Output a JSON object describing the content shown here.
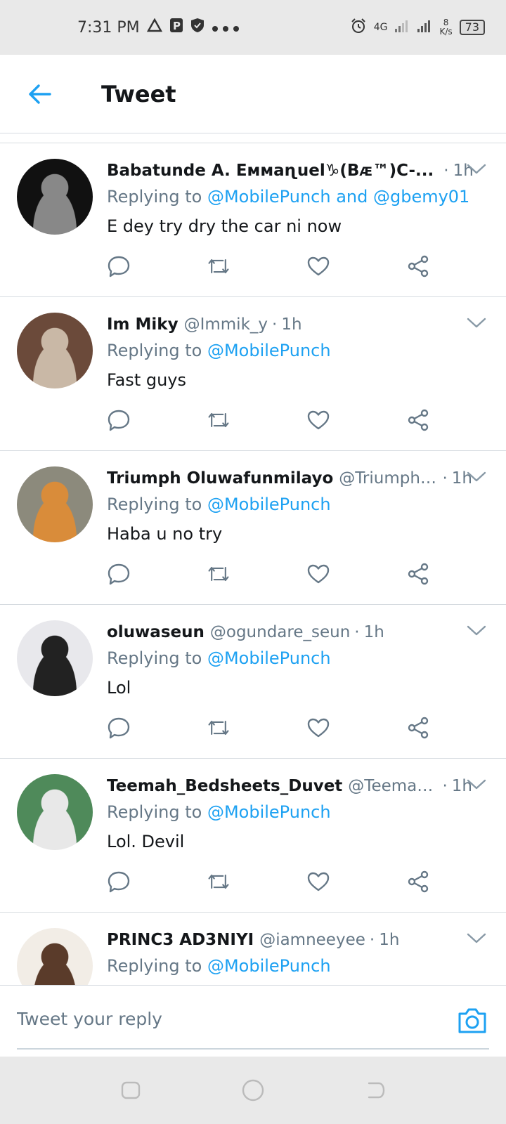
{
  "status_bar": {
    "time": "7:31 PM",
    "network": "4G",
    "speed_value": "8",
    "speed_unit": "K/s",
    "battery": "73"
  },
  "header": {
    "title": "Tweet"
  },
  "tweets": [
    {
      "name": "Babatunde A. Eᴍᴍaɳuel♑(Bᴁ™)C-...",
      "handle": "",
      "time": "1h",
      "replying_prefix": "Replying to",
      "replying_to": "@MobilePunch and @gbemy01",
      "text": "E dey try dry the car ni now",
      "avatar_colors": [
        "#111",
        "#888"
      ]
    },
    {
      "name": "Im Miky",
      "handle": "@Immik_y",
      "time": "1h",
      "replying_prefix": "Replying to",
      "replying_to": "@MobilePunch",
      "text": "Fast guys",
      "avatar_colors": [
        "#6b4a3a",
        "#c9b8a6"
      ]
    },
    {
      "name": "Triumph Oluwafunmilayo",
      "handle": "@TriumphOlu...",
      "time": "1h",
      "replying_prefix": "Replying to",
      "replying_to": "@MobilePunch",
      "text": "Haba u no try",
      "avatar_colors": [
        "#8c8a7c",
        "#d98c3a"
      ]
    },
    {
      "name": "oluwaseun",
      "handle": "@ogundare_seun",
      "time": "1h",
      "replying_prefix": "Replying to",
      "replying_to": "@MobilePunch",
      "text": "Lol",
      "avatar_colors": [
        "#e8e8ec",
        "#222"
      ]
    },
    {
      "name": "Teemah_Bedsheets_Duvet",
      "handle": "@Teemah_...",
      "time": "1h",
      "replying_prefix": "Replying to",
      "replying_to": "@MobilePunch",
      "text": "Lol. Devil",
      "avatar_colors": [
        "#4f8a5a",
        "#e8e8e8"
      ]
    },
    {
      "name": "PRINC3 AD3NIYI",
      "handle": "@iamneeyee",
      "time": "1h",
      "replying_prefix": "Replying to",
      "replying_to": "@MobilePunch",
      "text": "",
      "avatar_colors": [
        "#f2ede6",
        "#5a3b2a"
      ]
    }
  ],
  "reply_bar": {
    "placeholder": "Tweet your reply"
  },
  "colors": {
    "accent": "#1da1f2",
    "secondary_text": "#657786",
    "divider": "#d6dbe0"
  }
}
